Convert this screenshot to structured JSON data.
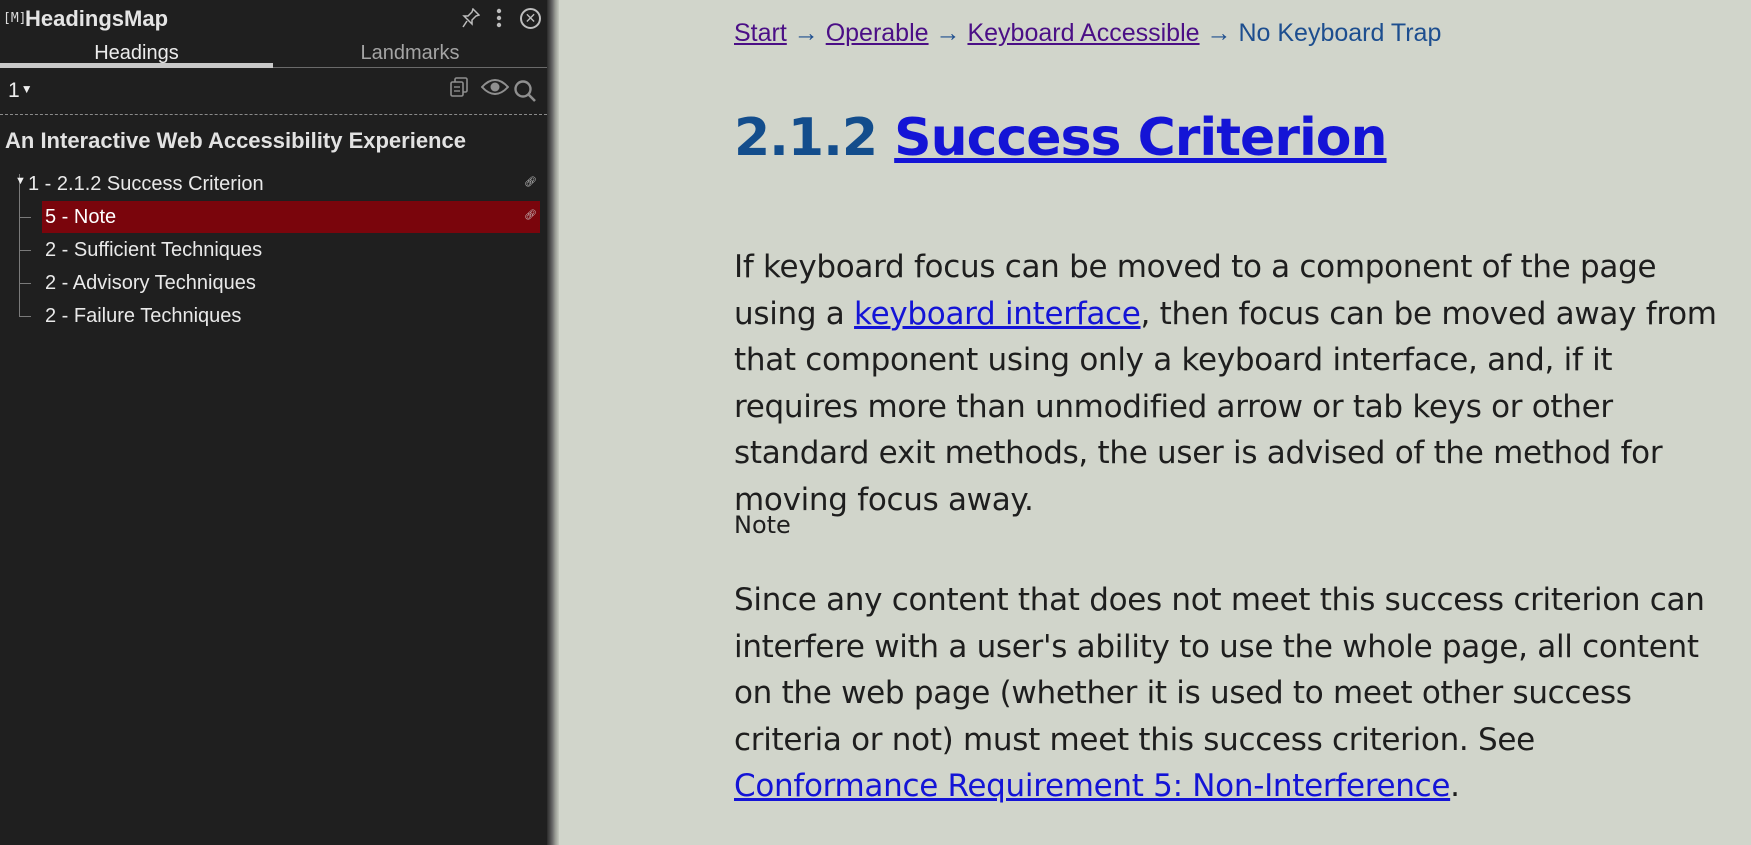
{
  "sidebar": {
    "logo": "[M]",
    "title": "HeadingsMap",
    "tabs": [
      {
        "label": "Headings",
        "active": true
      },
      {
        "label": "Landmarks",
        "active": false
      }
    ],
    "level_select": "1",
    "document_title": "An Interactive Web Accessibility Experience",
    "tree": [
      {
        "label": "1 - 2.1.2 Success Criterion",
        "level": 1,
        "has_link": true,
        "active": false
      },
      {
        "label": "5 - Note",
        "level": 2,
        "has_link": true,
        "active": true
      },
      {
        "label": "2 - Sufficient Techniques",
        "level": 2,
        "has_link": false,
        "active": false
      },
      {
        "label": "2 - Advisory Techniques",
        "level": 2,
        "has_link": false,
        "active": false
      },
      {
        "label": "2 - Failure Techniques",
        "level": 2,
        "has_link": false,
        "active": false
      }
    ],
    "icons": [
      "pin-icon",
      "kebab-menu-icon",
      "close-icon",
      "copy-icon",
      "eye-icon",
      "search-icon",
      "link-icon"
    ]
  },
  "breadcrumb": {
    "items": [
      "Start",
      "Operable",
      "Keyboard Accessible"
    ],
    "separator": "→",
    "current": "No Keyboard Trap"
  },
  "page": {
    "title_number": "2.1.2",
    "title_link": "Success Criterion",
    "para1": {
      "prefix": "If keyboard focus can be moved to a component of the page using a ",
      "link": "keyboard interface",
      "suffix": ", then focus can be moved away from that component using only a keyboard interface, and, if it requires more than unmodified arrow or tab keys or other standard exit methods, the user is advised of the method for moving focus away."
    },
    "note_label": "Note",
    "para2": {
      "prefix": "Since any content that does not meet this success criterion can interfere with a user's ability to use the whole page, all content on the web page (whether it is used to meet other success criteria or not) must meet this success criterion. See ",
      "link": "Conformance Requirement 5: Non-Interference",
      "suffix": "."
    }
  },
  "colors": {
    "sidebar_bg": "#1f1f1f",
    "active_row": "#7a050c",
    "page_bg": "#d1d5cb",
    "heading_blue": "#134d8c",
    "link_blue": "#1414d6",
    "visited_link": "#4b0f86"
  }
}
